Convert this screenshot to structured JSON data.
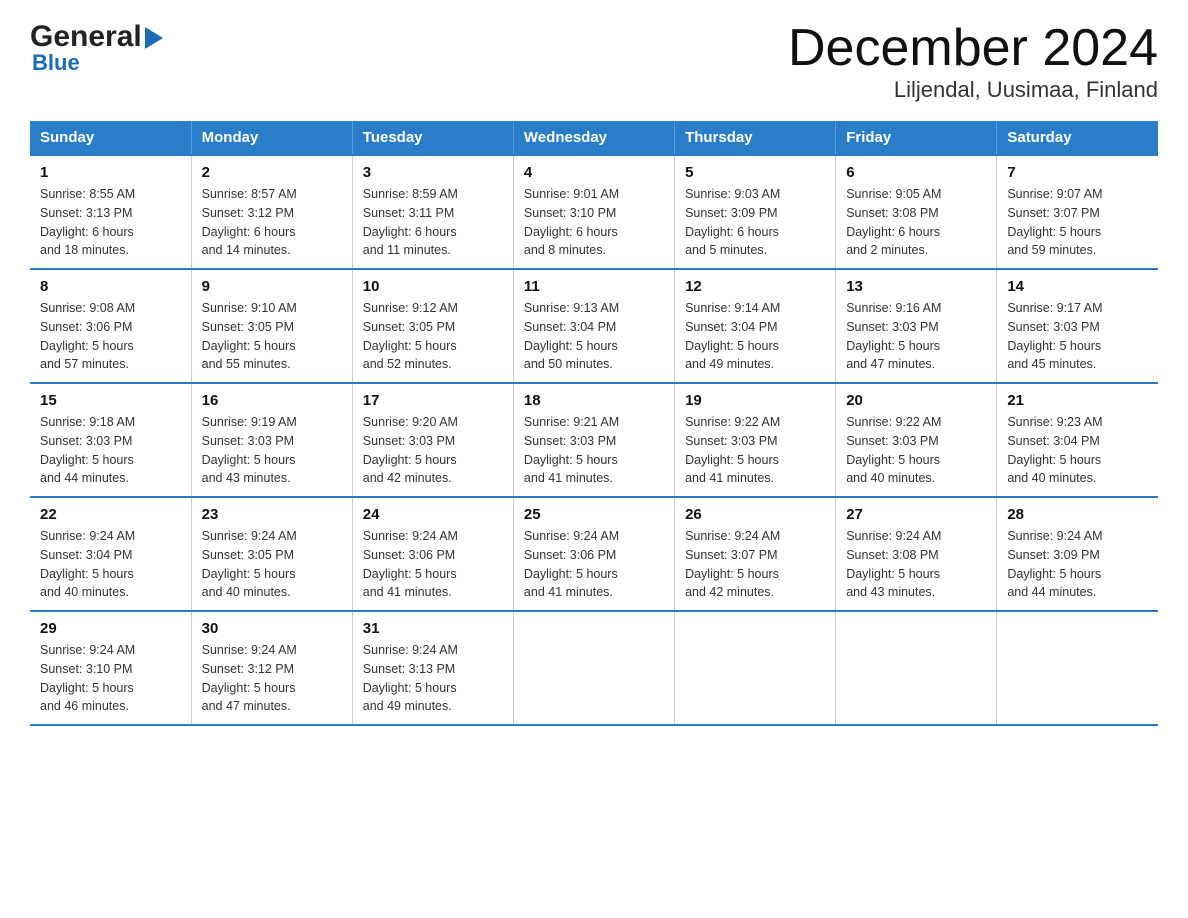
{
  "header": {
    "logo_general": "General",
    "logo_blue": "Blue",
    "month_title": "December 2024",
    "subtitle": "Liljendal, Uusimaa, Finland"
  },
  "weekdays": [
    "Sunday",
    "Monday",
    "Tuesday",
    "Wednesday",
    "Thursday",
    "Friday",
    "Saturday"
  ],
  "weeks": [
    [
      {
        "day": "1",
        "sunrise": "8:55 AM",
        "sunset": "3:13 PM",
        "daylight": "6 hours and 18 minutes."
      },
      {
        "day": "2",
        "sunrise": "8:57 AM",
        "sunset": "3:12 PM",
        "daylight": "6 hours and 14 minutes."
      },
      {
        "day": "3",
        "sunrise": "8:59 AM",
        "sunset": "3:11 PM",
        "daylight": "6 hours and 11 minutes."
      },
      {
        "day": "4",
        "sunrise": "9:01 AM",
        "sunset": "3:10 PM",
        "daylight": "6 hours and 8 minutes."
      },
      {
        "day": "5",
        "sunrise": "9:03 AM",
        "sunset": "3:09 PM",
        "daylight": "6 hours and 5 minutes."
      },
      {
        "day": "6",
        "sunrise": "9:05 AM",
        "sunset": "3:08 PM",
        "daylight": "6 hours and 2 minutes."
      },
      {
        "day": "7",
        "sunrise": "9:07 AM",
        "sunset": "3:07 PM",
        "daylight": "5 hours and 59 minutes."
      }
    ],
    [
      {
        "day": "8",
        "sunrise": "9:08 AM",
        "sunset": "3:06 PM",
        "daylight": "5 hours and 57 minutes."
      },
      {
        "day": "9",
        "sunrise": "9:10 AM",
        "sunset": "3:05 PM",
        "daylight": "5 hours and 55 minutes."
      },
      {
        "day": "10",
        "sunrise": "9:12 AM",
        "sunset": "3:05 PM",
        "daylight": "5 hours and 52 minutes."
      },
      {
        "day": "11",
        "sunrise": "9:13 AM",
        "sunset": "3:04 PM",
        "daylight": "5 hours and 50 minutes."
      },
      {
        "day": "12",
        "sunrise": "9:14 AM",
        "sunset": "3:04 PM",
        "daylight": "5 hours and 49 minutes."
      },
      {
        "day": "13",
        "sunrise": "9:16 AM",
        "sunset": "3:03 PM",
        "daylight": "5 hours and 47 minutes."
      },
      {
        "day": "14",
        "sunrise": "9:17 AM",
        "sunset": "3:03 PM",
        "daylight": "5 hours and 45 minutes."
      }
    ],
    [
      {
        "day": "15",
        "sunrise": "9:18 AM",
        "sunset": "3:03 PM",
        "daylight": "5 hours and 44 minutes."
      },
      {
        "day": "16",
        "sunrise": "9:19 AM",
        "sunset": "3:03 PM",
        "daylight": "5 hours and 43 minutes."
      },
      {
        "day": "17",
        "sunrise": "9:20 AM",
        "sunset": "3:03 PM",
        "daylight": "5 hours and 42 minutes."
      },
      {
        "day": "18",
        "sunrise": "9:21 AM",
        "sunset": "3:03 PM",
        "daylight": "5 hours and 41 minutes."
      },
      {
        "day": "19",
        "sunrise": "9:22 AM",
        "sunset": "3:03 PM",
        "daylight": "5 hours and 41 minutes."
      },
      {
        "day": "20",
        "sunrise": "9:22 AM",
        "sunset": "3:03 PM",
        "daylight": "5 hours and 40 minutes."
      },
      {
        "day": "21",
        "sunrise": "9:23 AM",
        "sunset": "3:04 PM",
        "daylight": "5 hours and 40 minutes."
      }
    ],
    [
      {
        "day": "22",
        "sunrise": "9:24 AM",
        "sunset": "3:04 PM",
        "daylight": "5 hours and 40 minutes."
      },
      {
        "day": "23",
        "sunrise": "9:24 AM",
        "sunset": "3:05 PM",
        "daylight": "5 hours and 40 minutes."
      },
      {
        "day": "24",
        "sunrise": "9:24 AM",
        "sunset": "3:06 PM",
        "daylight": "5 hours and 41 minutes."
      },
      {
        "day": "25",
        "sunrise": "9:24 AM",
        "sunset": "3:06 PM",
        "daylight": "5 hours and 41 minutes."
      },
      {
        "day": "26",
        "sunrise": "9:24 AM",
        "sunset": "3:07 PM",
        "daylight": "5 hours and 42 minutes."
      },
      {
        "day": "27",
        "sunrise": "9:24 AM",
        "sunset": "3:08 PM",
        "daylight": "5 hours and 43 minutes."
      },
      {
        "day": "28",
        "sunrise": "9:24 AM",
        "sunset": "3:09 PM",
        "daylight": "5 hours and 44 minutes."
      }
    ],
    [
      {
        "day": "29",
        "sunrise": "9:24 AM",
        "sunset": "3:10 PM",
        "daylight": "5 hours and 46 minutes."
      },
      {
        "day": "30",
        "sunrise": "9:24 AM",
        "sunset": "3:12 PM",
        "daylight": "5 hours and 47 minutes."
      },
      {
        "day": "31",
        "sunrise": "9:24 AM",
        "sunset": "3:13 PM",
        "daylight": "5 hours and 49 minutes."
      },
      null,
      null,
      null,
      null
    ]
  ],
  "labels": {
    "sunrise": "Sunrise:",
    "sunset": "Sunset:",
    "daylight": "Daylight:"
  }
}
